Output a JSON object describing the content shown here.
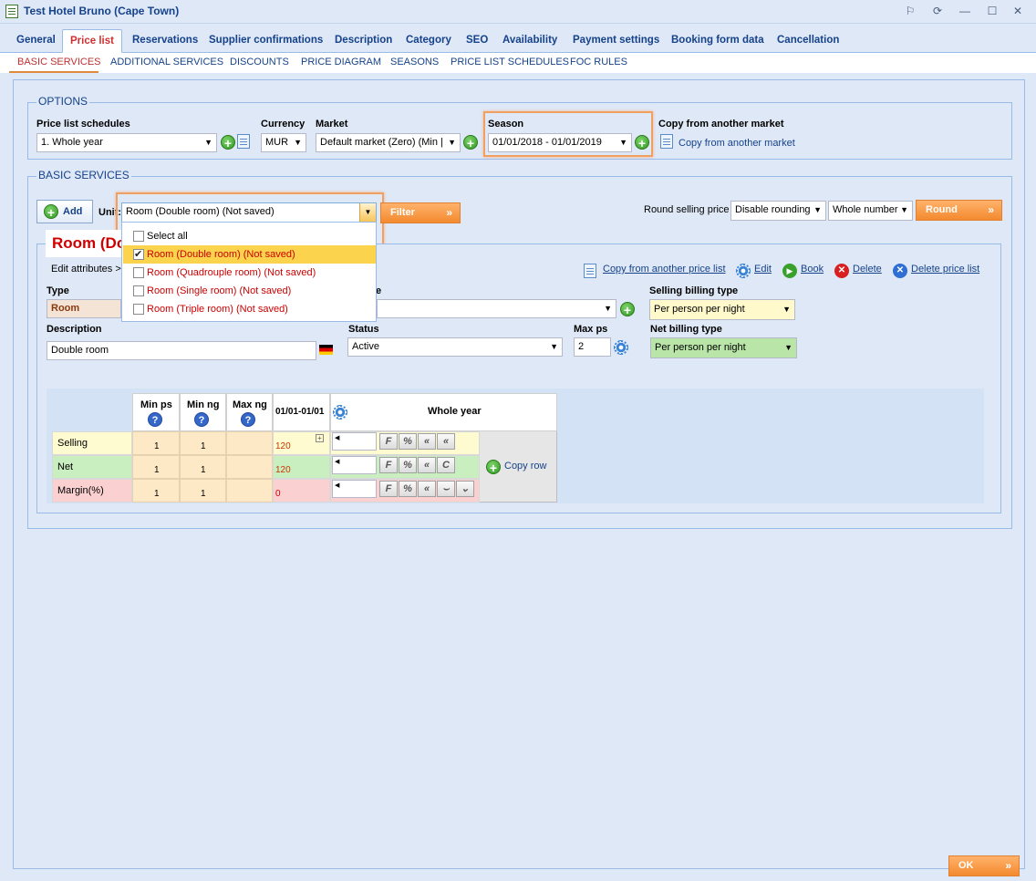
{
  "window": {
    "title": "Test Hotel Bruno (Cape Town)",
    "controls": [
      "⚐",
      "⟳",
      "—",
      "☐",
      "✕"
    ]
  },
  "main_tabs": [
    {
      "label": "General"
    },
    {
      "label": "Price list"
    },
    {
      "label": "Reservations"
    },
    {
      "label": "Supplier confirmations"
    },
    {
      "label": "Description"
    },
    {
      "label": "Category"
    },
    {
      "label": "SEO"
    },
    {
      "label": "Availability"
    },
    {
      "label": "Payment settings"
    },
    {
      "label": "Booking form data"
    },
    {
      "label": "Cancellation"
    }
  ],
  "sub_tabs": [
    {
      "label": "BASIC SERVICES"
    },
    {
      "label": "ADDITIONAL SERVICES"
    },
    {
      "label": "DISCOUNTS"
    },
    {
      "label": "PRICE DIAGRAM"
    },
    {
      "label": "SEASONS"
    },
    {
      "label": "PRICE LIST SCHEDULES"
    },
    {
      "label": "FOC RULES"
    }
  ],
  "options": {
    "legend": "OPTIONS",
    "schedules_label": "Price list schedules",
    "schedules_value": "1. Whole year",
    "currency_label": "Currency",
    "currency_value": "MUR",
    "market_label": "Market",
    "market_value": "Default market (Zero) (Min |",
    "season_label": "Season",
    "season_value": "01/01/2018 - 01/01/2019",
    "copy_label": "Copy from another market",
    "copy_link": "Copy from another market"
  },
  "basic": {
    "legend": "BASIC SERVICES",
    "add_label": "Add",
    "unit_label": "Unit:",
    "unit_value": "Room (Double room) (Not saved)",
    "filter_label": "Filter",
    "round_label": "Round selling price",
    "rounding_value": "Disable rounding",
    "number_value": "Whole number",
    "round_button": "Round"
  },
  "dropdown": [
    {
      "label": "Select all",
      "checked": false,
      "selected": false,
      "color": "#000000"
    },
    {
      "label": "Room (Double room) (Not saved)",
      "checked": true,
      "selected": true,
      "color": "#cc0000"
    },
    {
      "label": "Room (Quadrouple room) (Not saved)",
      "checked": false,
      "selected": false,
      "color": "#cc0000"
    },
    {
      "label": "Room (Single room) (Not saved)",
      "checked": false,
      "selected": false,
      "color": "#cc0000"
    },
    {
      "label": "Room (Triple room) (Not saved)",
      "checked": false,
      "selected": false,
      "color": "#cc0000"
    }
  ],
  "room": {
    "title_visible": "Room (Do",
    "edit_attributes": "Edit attributes >",
    "copy_pricelist": "Copy from another price list",
    "edit": "Edit",
    "book": "Book",
    "delete": "Delete",
    "delete_pricelist": "Delete price list",
    "type_label": "Type",
    "type_value": "Room",
    "type2_label_partial": "e",
    "selling_billing_label": "Selling billing type",
    "selling_billing_value": "Per person per night",
    "description_label": "Description",
    "description_value": "Double room",
    "status_label": "Status",
    "status_value": "Active",
    "maxps_label": "Max ps",
    "maxps_value": "2",
    "net_billing_label": "Net billing type",
    "net_billing_value": "Per person per night"
  },
  "price_table": {
    "headers": {
      "min_ps": "Min ps",
      "min_ng": "Min ng",
      "max_ng": "Max ng",
      "period": "01/01-01/01",
      "whole_year": "Whole year"
    },
    "rows": [
      {
        "label": "Selling",
        "min_ps": "1",
        "min_ng": "1",
        "max_ng": "",
        "value": "120",
        "bg": "#fffbd0",
        "valcolor": "#cc3300"
      },
      {
        "label": "Net",
        "min_ps": "1",
        "min_ng": "1",
        "max_ng": "",
        "value": "120",
        "bg": "#c9efc0",
        "valcolor": "#cc3300"
      },
      {
        "label": "Margin(%)",
        "min_ps": "1",
        "min_ng": "1",
        "max_ng": "",
        "value": "0",
        "bg": "#fbd0d0",
        "valcolor": "#cc0000"
      }
    ],
    "copy_row": "Copy row",
    "buttons": {
      "f": "F",
      "pct": "%",
      "back": "«",
      "c": "C"
    }
  },
  "footer": {
    "ok": "OK"
  }
}
